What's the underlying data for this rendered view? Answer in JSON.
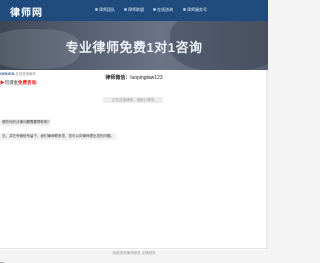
{
  "nav": {
    "logo": "律师网",
    "items": [
      {
        "label": "律师团队"
      },
      {
        "label": "律师联盟"
      },
      {
        "label": "在线咨询"
      },
      {
        "label": "律师服务号"
      }
    ]
  },
  "hero": {
    "title": "专业律师免费1对1咨询"
  },
  "chat": {
    "brand": "ORNDS",
    "brand_sub": "在线咨询律师",
    "headline_prefix": "何谓金",
    "headline_highlight": "免费咨询:",
    "title_prefix": "律师微信：",
    "title_value": "luopingtaw123",
    "system_msg": "正在连接律师，请耐心等待",
    "messages": [
      "哪些你的法律问题需要帮助呢?",
      "式，并在号微信号留下，我们律师联系您，您可以向律师提出您的问题。"
    ]
  },
  "footer": {
    "text": "网络咨询律师服务 法律服务"
  },
  "colors": {
    "nav": "#1f4c7d",
    "accent": "#e02020",
    "brand": "#2b5ea8"
  }
}
